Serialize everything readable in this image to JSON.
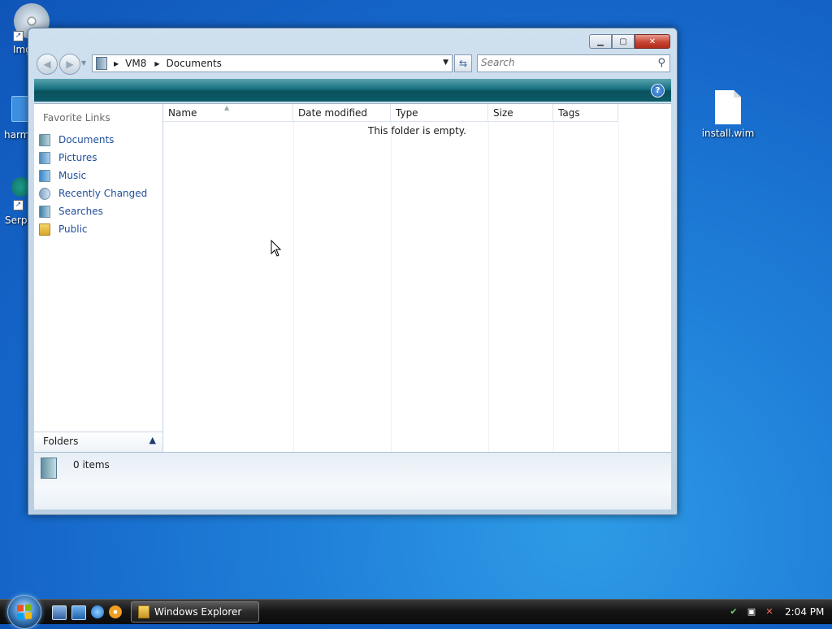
{
  "desktop": {
    "icons": [
      {
        "label": "install.wim"
      }
    ],
    "edge_labels": {
      "top": "Img",
      "middle": "harm",
      "bottom": "Serpe"
    }
  },
  "window": {
    "address": {
      "crumbs": [
        "VM8",
        "Documents"
      ]
    },
    "search": {
      "placeholder": "Search"
    },
    "favorites": {
      "title": "Favorite Links",
      "items": [
        {
          "label": "Documents",
          "icon": "documents-icon"
        },
        {
          "label": "Pictures",
          "icon": "pictures-icon"
        },
        {
          "label": "Music",
          "icon": "music-icon"
        },
        {
          "label": "Recently Changed",
          "icon": "recently-changed-icon"
        },
        {
          "label": "Searches",
          "icon": "searches-icon"
        },
        {
          "label": "Public",
          "icon": "public-folder-icon"
        }
      ]
    },
    "folders_label": "Folders",
    "columns": [
      "Name",
      "Date modified",
      "Type",
      "Size",
      "Tags"
    ],
    "empty_message": "This folder is empty.",
    "details": {
      "count": "0 items"
    }
  },
  "taskbar": {
    "task_label": "Windows Explorer",
    "clock": "2:04 PM"
  }
}
